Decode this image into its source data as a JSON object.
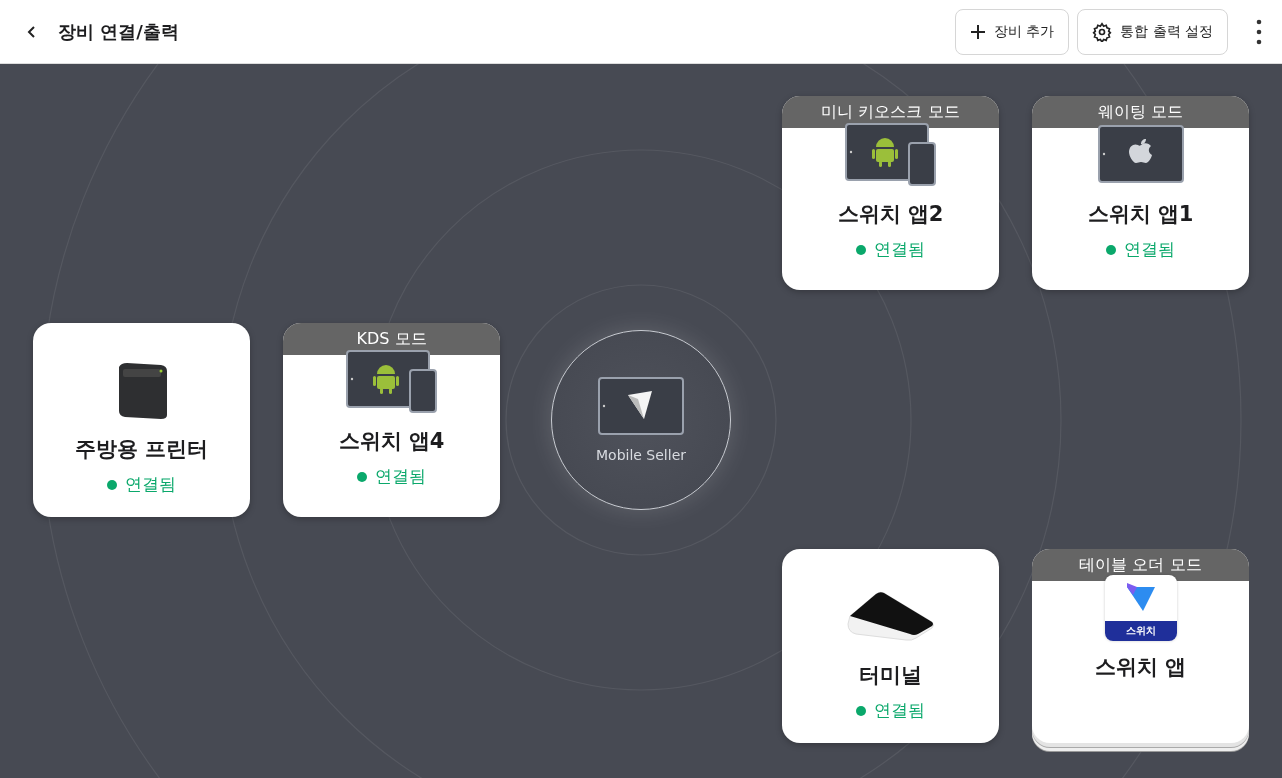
{
  "header": {
    "title": "장비 연결/출력",
    "buttons": [
      {
        "kind": "add",
        "label": "장비 추가"
      },
      {
        "kind": "settings",
        "label": "통합 출력 설정"
      }
    ]
  },
  "hub": {
    "label": "Mobile Seller"
  },
  "devices": [
    {
      "kind": "printer",
      "name": "주방용 프린터",
      "status": "연결됨",
      "connected": true,
      "stacked": false
    },
    {
      "kind": "android",
      "mode": "KDS 모드",
      "name": "스위치 앱4",
      "status": "연결됨",
      "connected": true,
      "stacked": false
    },
    {
      "kind": "android",
      "mode": "미니 키오스크 모드",
      "name": "스위치 앱2",
      "status": "연결됨",
      "connected": true,
      "stacked": false
    },
    {
      "kind": "apple",
      "mode": "웨이팅 모드",
      "name": "스위치 앱1",
      "status": "연결됨",
      "connected": true,
      "stacked": false
    },
    {
      "kind": "terminal",
      "name": "터미널",
      "status": "연결됨",
      "connected": true,
      "stacked": false
    },
    {
      "kind": "app",
      "mode": "테이블 오더 모드",
      "logo_text": "스위치",
      "name": "스위치 앱",
      "stacked": true
    }
  ]
}
